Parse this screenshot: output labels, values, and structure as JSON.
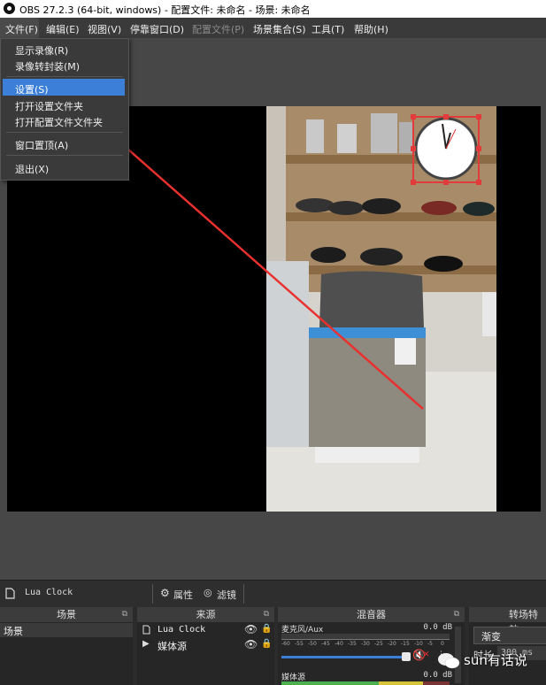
{
  "window": {
    "title": "OBS 27.2.3 (64-bit, windows) - 配置文件: 未命名 - 场景: 未命名"
  },
  "menu": {
    "file": "文件(F)",
    "edit": "编辑(E)",
    "view": "视图(V)",
    "dock": "停靠窗口(D)",
    "profile": "配置文件(P)",
    "scene_collection": "场景集合(S)",
    "tools": "工具(T)",
    "help": "帮助(H)"
  },
  "file_menu": {
    "show_recordings": "显示录像(R)",
    "remux": "录像转封装(M)",
    "settings": "设置(S)",
    "open_settings_folder": "打开设置文件夹",
    "open_profile_folder": "打开配置文件文件夹",
    "always_on_top": "窗口置顶(A)",
    "exit": "退出(X)"
  },
  "source_toolbar": {
    "source_name": "Lua Clock",
    "properties": "属性",
    "filters": "滤镜"
  },
  "scenes": {
    "header": "场景",
    "items": [
      "场景"
    ]
  },
  "sources": {
    "header": "来源",
    "items": [
      "Lua Clock",
      "媒体源"
    ]
  },
  "mixer": {
    "header": "混音器",
    "channels": [
      {
        "name": "麦克风/Aux",
        "db": "0.0 dB"
      },
      {
        "name": "媒体源",
        "db": "0.0 dB"
      }
    ],
    "ticks": [
      "-60",
      "-55",
      "-50",
      "-45",
      "-40",
      "-35",
      "-30",
      "-25",
      "-20",
      "-15",
      "-10",
      "-5",
      "0"
    ]
  },
  "transitions": {
    "header": "转场特效",
    "type": "渐变",
    "duration_label": "时长",
    "duration_value": "300 ms"
  },
  "watermark": "sun有话说",
  "colors": {
    "accent": "#3b7fd8",
    "arrow": "#e8312f",
    "meter_green": "#4caf50",
    "meter_yellow": "#d6c43a"
  }
}
